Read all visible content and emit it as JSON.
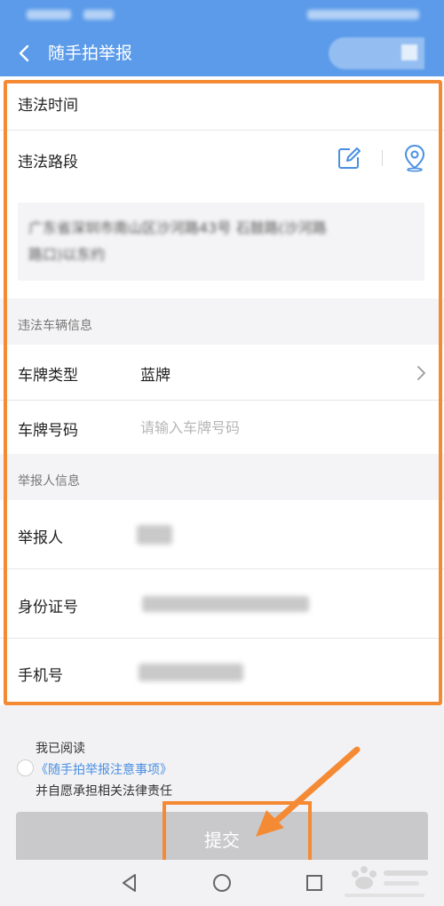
{
  "app_bar": {
    "title": "随手拍举报",
    "back_icon": "chevron-left-icon",
    "bg_color": "#5b9bea"
  },
  "violation": {
    "time_label": "违法时间",
    "road_label": "违法路段",
    "edit_icon": "edit-icon",
    "location_icon": "location-pin-icon",
    "address_line1": "广东省深圳市南山区沙河路43号 石鼓路(沙河路",
    "address_line2": "路口)以东约"
  },
  "vehicle_section": {
    "header": "违法车辆信息",
    "plate_type_label": "车牌类型",
    "plate_type_value": "蓝牌",
    "plate_number_label": "车牌号码",
    "plate_number_placeholder": "请输入车牌号码"
  },
  "reporter_section": {
    "header": "举报人信息",
    "reporter_label": "举报人",
    "id_label": "身份证号",
    "phone_label": "手机号"
  },
  "agreement": {
    "line1": "我已阅读",
    "link": "《随手拍举报注意事项》",
    "line2": "并自愿承担相关法律责任"
  },
  "submit": {
    "label": "提交"
  },
  "colors": {
    "accent": "#5b9bea",
    "highlight": "#f58a34",
    "link": "#4a8fe0",
    "submit_disabled": "#c9c9cc"
  }
}
